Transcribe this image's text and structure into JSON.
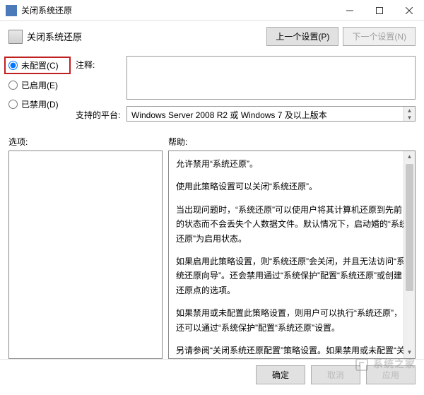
{
  "window": {
    "title": "关闭系统还原"
  },
  "header": {
    "title": "关闭系统还原",
    "prev_button": "上一个设置(P)",
    "next_button": "下一个设置(N)"
  },
  "radios": {
    "not_configured": "未配置(C)",
    "enabled": "已启用(E)",
    "disabled": "已禁用(D)"
  },
  "config": {
    "comment_label": "注释:",
    "comment_value": "",
    "platform_label": "支持的平台:",
    "platform_value": "Windows Server 2008 R2 或 Windows 7 及以上版本"
  },
  "labels": {
    "options": "选项:",
    "help": "帮助:"
  },
  "help_text": {
    "p1": "允许禁用“系统还原”。",
    "p2": "使用此策略设置可以关闭“系统还原”。",
    "p3": "当出现问题时，“系统还原”可以使用户将其计算机还原到先前的状态而不会丢失个人数据文件。默认情况下，启动婚的“系统还原”为启用状态。",
    "p4": "如果启用此策略设置，则“系统还原”会关闭，并且无法访问“系统还原向导”。还会禁用通过“系统保护”配置“系统还原”或创建还原点的选项。",
    "p5": "如果禁用或未配置此策略设置，则用户可以执行“系统还原”，还可以通过“系统保护”配置“系统还原”设置。",
    "p6": "另请参阅“关闭系统还原配置”策略设置。如果禁用或未配置“关闭系统还原”策略设置，则可以使用“关闭系统还原配置”策略设置来确定配置“系统还原”的选项是否可用。"
  },
  "footer": {
    "ok": "确定",
    "cancel": "取消",
    "apply": "应用"
  },
  "watermark": "系统之家"
}
